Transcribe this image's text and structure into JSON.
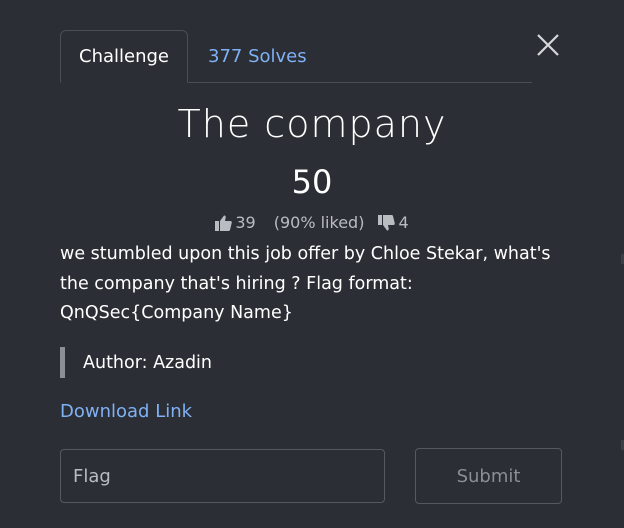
{
  "tabs": {
    "challenge_label": "Challenge",
    "solves_label": "377 Solves"
  },
  "challenge": {
    "title": "The company",
    "points": "50",
    "likes": "39",
    "liked_percent": "(90% liked)",
    "dislikes": "4",
    "description": "we stumbled upon this job offer by Chloe Stekar, what's the company that's hiring ? Flag format: QnQSec{Company Name}",
    "author": "Author: Azadin",
    "download_label": "Download Link"
  },
  "form": {
    "flag_placeholder": "Flag",
    "submit_label": "Submit"
  },
  "icons": {
    "close": "close-icon",
    "like": "thumbs-up-icon",
    "dislike": "thumbs-down-icon"
  }
}
